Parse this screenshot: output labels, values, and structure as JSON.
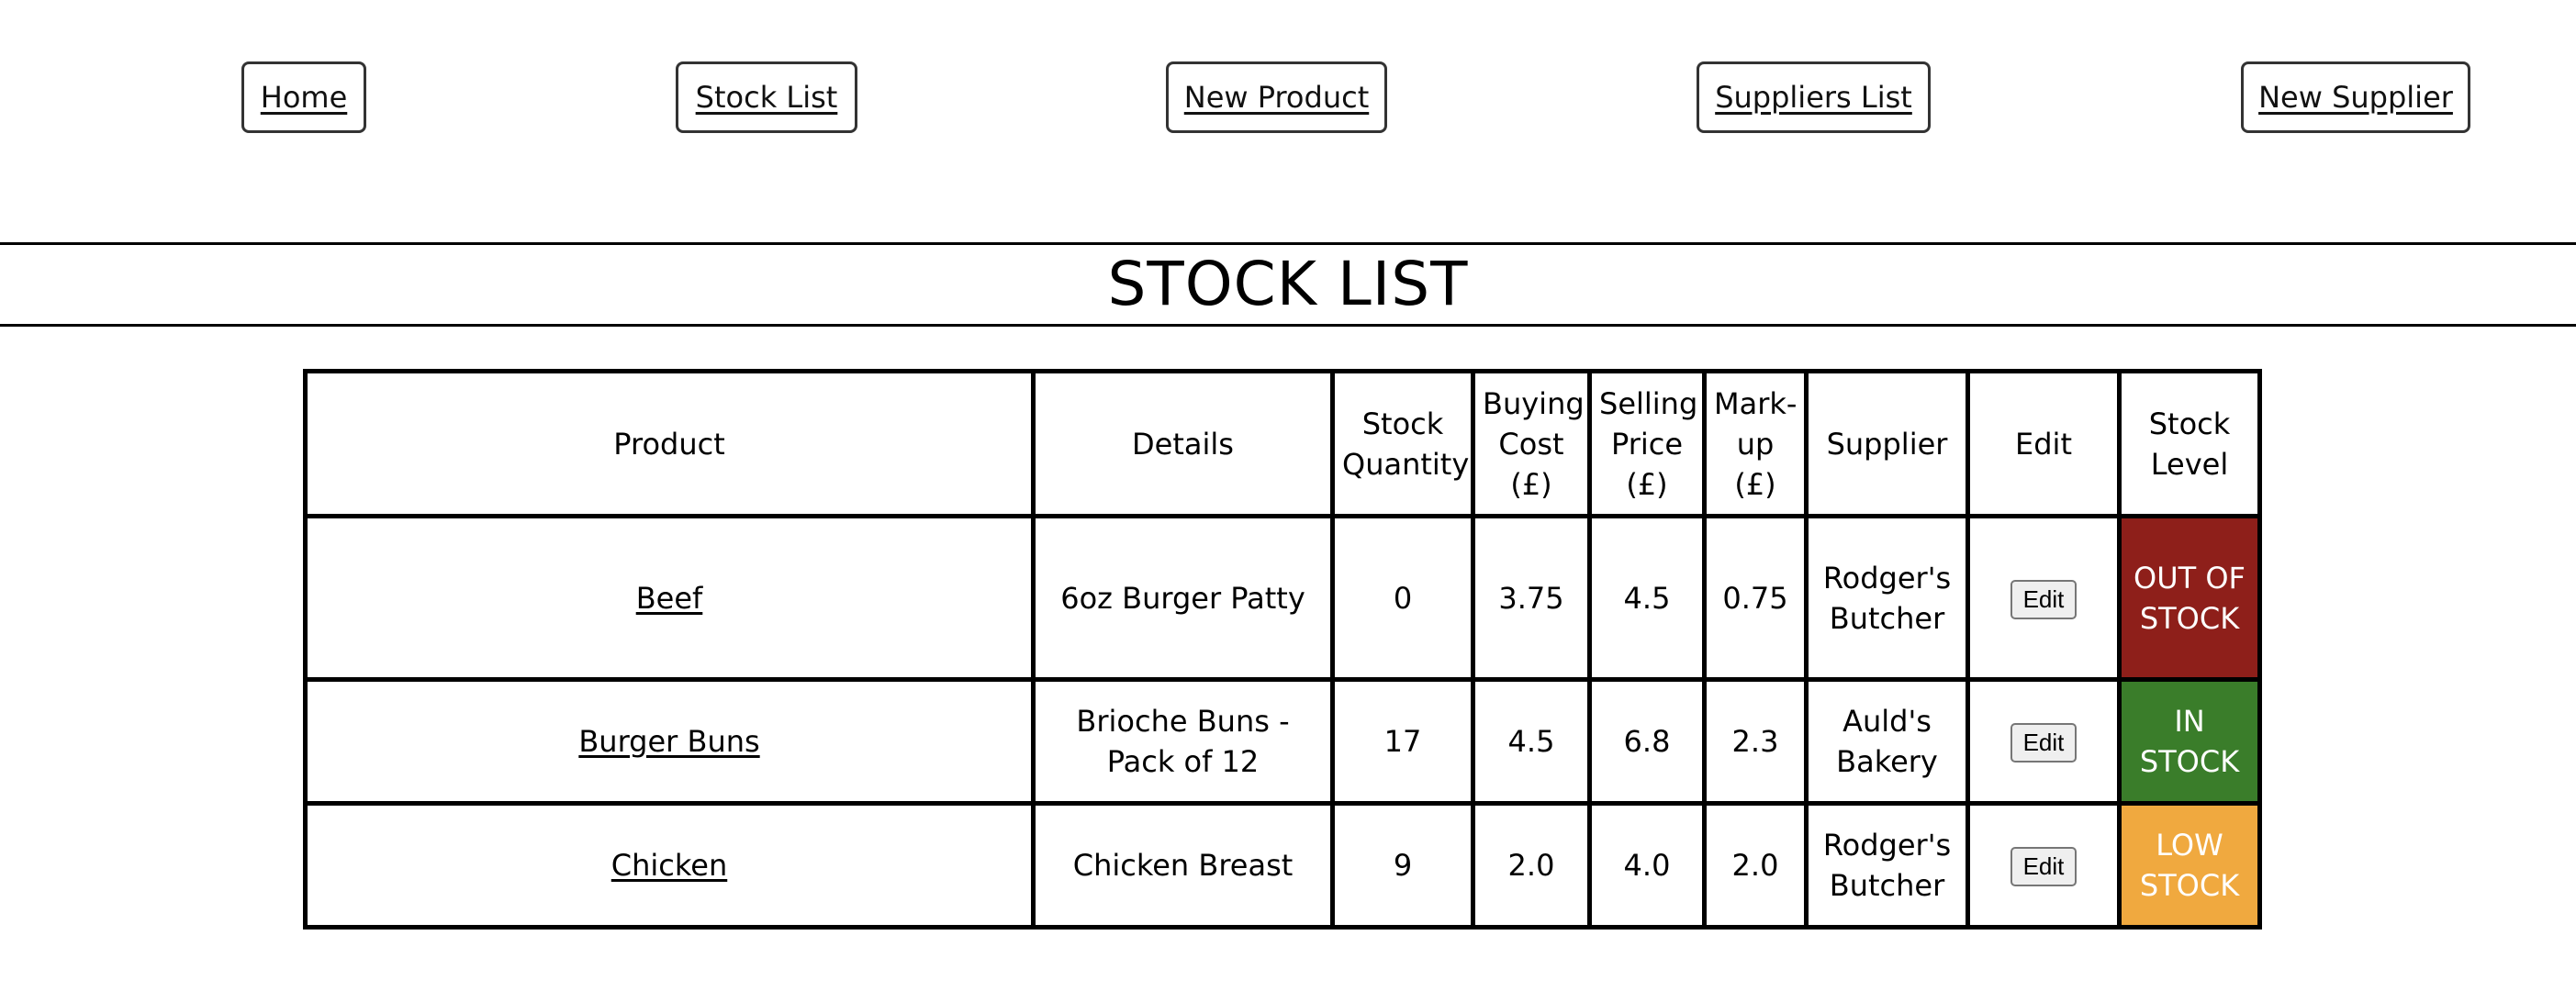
{
  "nav": {
    "home": "Home",
    "stock_list": "Stock List",
    "new_product": "New Product",
    "suppliers_list": "Suppliers List",
    "new_supplier": "New Supplier"
  },
  "page_title": "STOCK LIST",
  "table": {
    "headers": {
      "product": "Product",
      "details": "Details",
      "stock_quantity": "Stock Quantity",
      "buying_cost": "Buying Cost (£)",
      "selling_price": "Selling Price (£)",
      "markup": "Mark-up (£)",
      "supplier": "Supplier",
      "edit": "Edit",
      "stock_level": "Stock Level"
    },
    "rows": [
      {
        "product": "Beef",
        "details": "6oz Burger Patty",
        "stock_quantity": "0",
        "buying_cost": "3.75",
        "selling_price": "4.5",
        "markup": "0.75",
        "supplier": "Rodger's Butcher",
        "edit_label": "Edit",
        "stock_level": "OUT OF STOCK",
        "level_color": "#8e1f1a"
      },
      {
        "product": "Burger Buns",
        "details": "Brioche Buns - Pack of 12",
        "stock_quantity": "17",
        "buying_cost": "4.5",
        "selling_price": "6.8",
        "markup": "2.3",
        "supplier": "Auld's Bakery",
        "edit_label": "Edit",
        "stock_level": "IN STOCK",
        "level_color": "#3a7d2a"
      },
      {
        "product": "Chicken",
        "details": "Chicken Breast",
        "stock_quantity": "9",
        "buying_cost": "2.0",
        "selling_price": "4.0",
        "markup": "2.0",
        "supplier": "Rodger's Butcher",
        "edit_label": "Edit",
        "stock_level": "LOW STOCK",
        "level_color": "#f0a93f"
      }
    ]
  }
}
